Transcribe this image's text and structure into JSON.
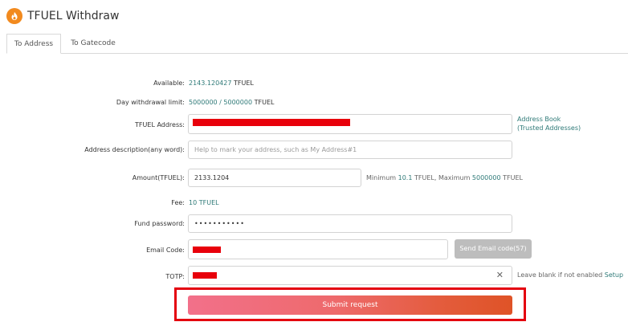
{
  "header": {
    "title": "TFUEL Withdraw",
    "logo_icon": "theta-flame-icon",
    "logo_color": "#f28a1e"
  },
  "tabs": [
    {
      "label": "To Address",
      "active": true
    },
    {
      "label": "To Gatecode",
      "active": false
    }
  ],
  "form": {
    "available": {
      "label": "Available:",
      "value": "2143.120427",
      "unit": "TFUEL"
    },
    "day_limit": {
      "label": "Day withdrawal limit:",
      "value": "5000000 / 5000000",
      "unit": "TFUEL"
    },
    "address": {
      "label": "TFUEL Address:",
      "value_redacted": true,
      "address_book": "Address Book",
      "trusted": "(Trusted Addresses)"
    },
    "description": {
      "label": "Address description(any word):",
      "placeholder": "Help to mark your address, such as My Address#1"
    },
    "amount": {
      "label": "Amount(TFUEL):",
      "value": "2133.1204",
      "min_prefix": "Minimum",
      "min_value": "10.1",
      "min_unit": "TFUEL,",
      "max_prefix": "Maximum",
      "max_value": "5000000",
      "max_unit": "TFUEL"
    },
    "fee": {
      "label": "Fee:",
      "value": "10 TFUEL"
    },
    "fund_password": {
      "label": "Fund password:",
      "value": "•••••••••••"
    },
    "email_code": {
      "label": "Email Code:",
      "value_redacted": true,
      "send_button": "Send Email code(57)"
    },
    "totp": {
      "label": "TOTP:",
      "value_redacted": true,
      "clear_icon": "close-icon",
      "note": "Leave blank if not enabled",
      "setup": "Setup"
    },
    "submit": {
      "label": "Submit request"
    }
  },
  "colors": {
    "accent_green": "#2f7a78",
    "redaction": "#e8000b",
    "highlight_frame": "#e4000f",
    "submit_gradient_start": "#f2708a",
    "submit_gradient_end": "#df5327",
    "disabled_button": "#bdbdbd"
  }
}
